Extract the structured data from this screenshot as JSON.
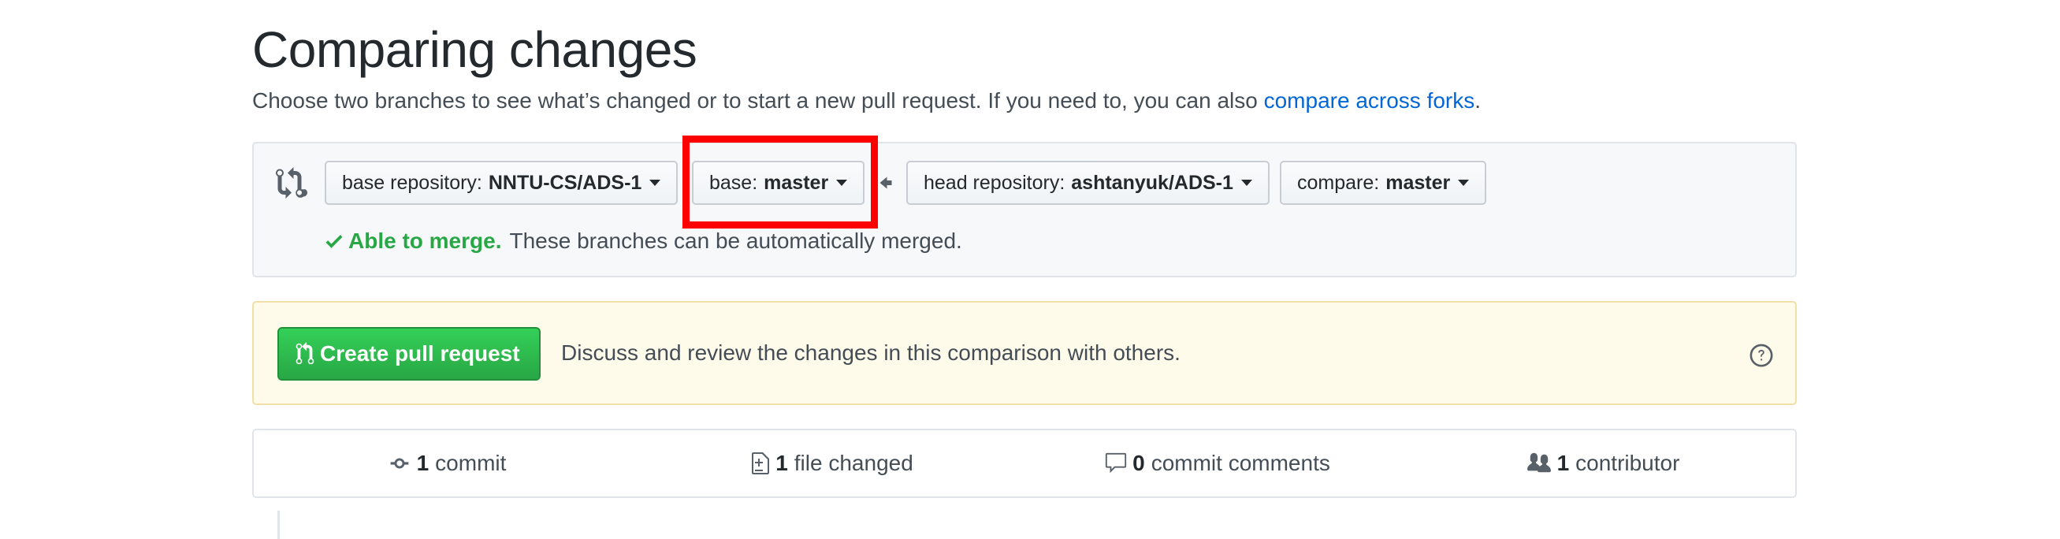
{
  "page": {
    "title": "Comparing changes",
    "subtitle": "Choose two branches to see what’s changed or to start a new pull request. If you need to, you can also ",
    "subtitle_link": "compare across forks",
    "subtitle_end": "."
  },
  "range": {
    "base_repo_label": "base repository:",
    "base_repo_value": "NNTU-CS/ADS-1",
    "base_label": "base:",
    "base_value": "master",
    "head_repo_label": "head repository:",
    "head_repo_value": "ashtanyuk/ADS-1",
    "compare_label": "compare:",
    "compare_value": "master",
    "merge_ok": "Able to merge.",
    "merge_msg": "These branches can be automatically merged."
  },
  "pr": {
    "button_label": "Create pull request",
    "text": "Discuss and review the changes in this comparison with others."
  },
  "summary": {
    "commits_num": "1",
    "commits_label": "commit",
    "files_num": "1",
    "files_label": "file changed",
    "comments_num": "0",
    "comments_label": "commit comments",
    "contributors_num": "1",
    "contributors_label": "contributor"
  },
  "colors": {
    "link": "#0366d6",
    "success": "#28a745",
    "highlight": "#ff0000",
    "notice_bg": "#fffbea"
  },
  "icons": [
    "git-compare-icon",
    "caret-down-icon",
    "arrow-left-icon",
    "check-icon",
    "git-pull-request-icon",
    "question-icon",
    "git-commit-icon",
    "file-diff-icon",
    "comment-icon",
    "people-icon"
  ]
}
